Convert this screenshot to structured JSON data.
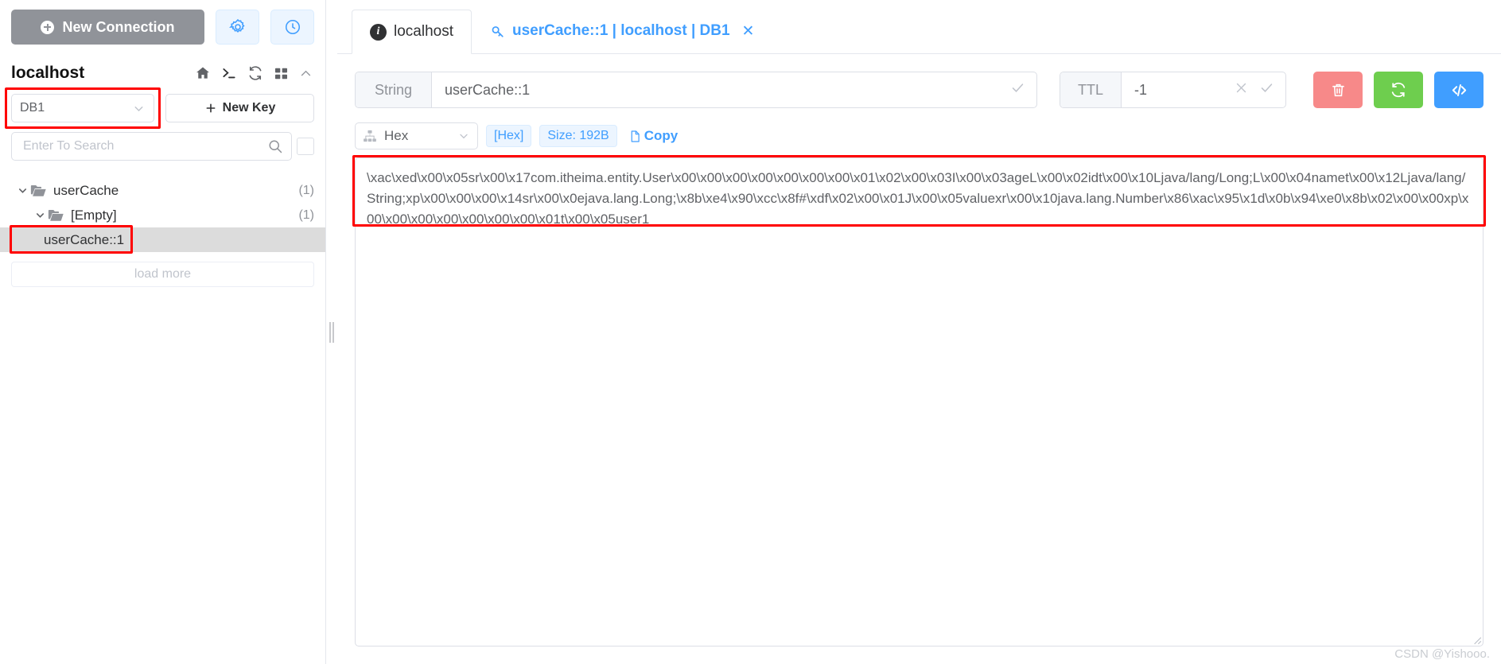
{
  "sidebar": {
    "new_connection_label": "New Connection",
    "icons": {
      "new_connection": "plus-circle-icon",
      "settings": "gear-icon",
      "history": "clock-icon",
      "home": "home-icon",
      "console": "terminal-icon",
      "refresh": "refresh-icon",
      "grid": "grid-icon",
      "collapse": "chevron-up-icon"
    },
    "host_name": "localhost",
    "db_select_value": "DB1",
    "new_key_label": "New Key",
    "search_placeholder": "Enter To Search",
    "search_value": "",
    "tree": [
      {
        "label": "userCache",
        "count": "(1)",
        "type": "folder",
        "depth": 0,
        "expanded": true,
        "selected": false
      },
      {
        "label": "[Empty]",
        "count": "(1)",
        "type": "folder",
        "depth": 1,
        "expanded": true,
        "selected": false
      },
      {
        "label": "userCache::1",
        "count": "",
        "type": "key",
        "depth": 2,
        "expanded": false,
        "selected": true
      }
    ],
    "load_more_label": "load more"
  },
  "tabs": [
    {
      "label": "localhost",
      "icon": "info-icon",
      "active": false,
      "closable": false
    },
    {
      "label": "userCache::1 | localhost | DB1",
      "icon": "key-icon",
      "active": true,
      "closable": true
    }
  ],
  "key_toolbar": {
    "type_label": "String",
    "key_value": "userCache::1",
    "key_confirm_icon": "check-icon",
    "ttl_label": "TTL",
    "ttl_value": "-1",
    "ttl_clear_icon": "close-icon",
    "ttl_confirm_icon": "check-icon",
    "actions": [
      {
        "name": "delete-key-button",
        "icon": "trash-icon",
        "color": "#f78989"
      },
      {
        "name": "reload-value-button",
        "icon": "refresh-icon",
        "color": "#6ece4e"
      },
      {
        "name": "view-source-button",
        "icon": "code-icon",
        "color": "#409eff"
      }
    ]
  },
  "view_toolbar": {
    "format_icon": "tree-icon",
    "format_value": "Hex",
    "encoding_tag": "[Hex]",
    "size_tag": "Size: 192B",
    "copy_label": "Copy",
    "copy_icon": "document-icon"
  },
  "value": {
    "content": "\\xac\\xed\\x00\\x05sr\\x00\\x17com.itheima.entity.User\\x00\\x00\\x00\\x00\\x00\\x00\\x00\\x01\\x02\\x00\\x03I\\x00\\x03ageL\\x00\\x02idt\\x00\\x10Ljava/lang/Long;L\\x00\\x04namet\\x00\\x12Ljava/lang/String;xp\\x00\\x00\\x00\\x14sr\\x00\\x0ejava.lang.Long;\\x8b\\xe4\\x90\\xcc\\x8f#\\xdf\\x02\\x00\\x01J\\x00\\x05valuexr\\x00\\x10java.lang.Number\\x86\\xac\\x95\\x1d\\x0b\\x94\\xe0\\x8b\\x02\\x00\\x00xp\\x00\\x00\\x00\\x00\\x00\\x00\\x00\\x01t\\x00\\x05user1"
  },
  "watermark": "CSDN @Yishooo.",
  "colors": {
    "accent": "#409eff",
    "danger": "#f78989",
    "success": "#6ece4e",
    "highlight_box": "#ff0000",
    "muted": "#909399"
  }
}
